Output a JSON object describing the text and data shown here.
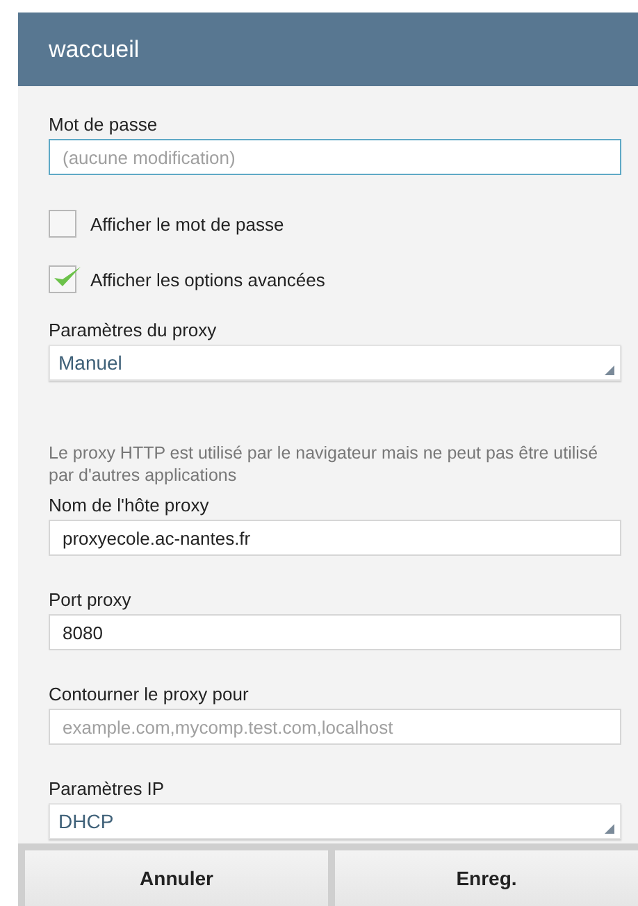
{
  "dialog": {
    "title": "waccueil"
  },
  "items": [
    {
      "kind": "input",
      "label": "Mot de passe",
      "placeholder": "(aucune modification)",
      "focused": true
    },
    {
      "kind": "checkbox",
      "label": "Afficher le mot de passe",
      "checked": false
    },
    {
      "kind": "checkbox",
      "label": "Afficher les options avancées",
      "checked": true
    },
    {
      "kind": "select",
      "label": "Paramètres du proxy",
      "value": "Manuel"
    },
    {
      "kind": "note",
      "text": "Le proxy HTTP est utilisé par le navigateur mais ne peut pas être utilisé par d'autres applications"
    },
    {
      "kind": "input",
      "label": "Nom de l'hôte proxy",
      "value": "proxyecole.ac-nantes.fr",
      "focused": false
    },
    {
      "kind": "input",
      "label": "Port proxy",
      "value": "8080",
      "focused": false
    },
    {
      "kind": "input",
      "label": "Contourner le proxy pour",
      "placeholder": "example.com,mycomp.test.com,localhost",
      "focused": false
    },
    {
      "kind": "select",
      "label": "Paramètres IP",
      "value": "DHCP"
    }
  ],
  "buttons": [
    "Annuler",
    "Enreg."
  ]
}
